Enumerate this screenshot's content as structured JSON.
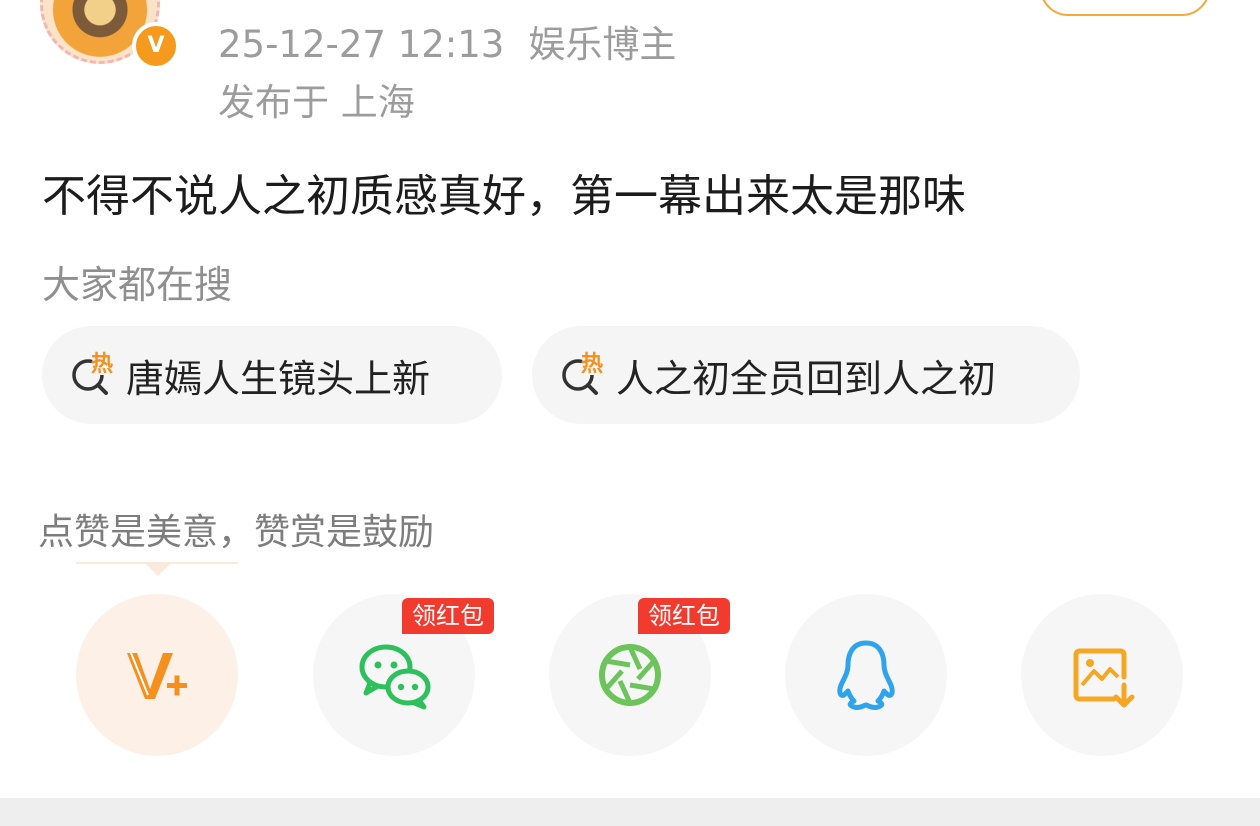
{
  "post": {
    "timestamp": "25-12-27 12:13",
    "author_tag": "娱乐博主",
    "location": "发布于 上海",
    "verified_badge": "V",
    "text": "不得不说人之初质感真好，第一幕出来太是那味"
  },
  "trending": {
    "title": "大家都在搜",
    "hot_icon_glyph": "热",
    "items": [
      {
        "label": "唐嫣人生镜头上新"
      },
      {
        "label": "人之初全员回到人之初"
      }
    ]
  },
  "reward": {
    "text": "点赞是美意，赞赏是鼓励"
  },
  "share": {
    "badge_label": "领红包",
    "buttons": [
      {
        "name": "reward-vplus",
        "icon": "v-plus-icon",
        "color": "#f5901e"
      },
      {
        "name": "wechat",
        "icon": "wechat-icon",
        "color": "#2ec05c",
        "badge": "领红包"
      },
      {
        "name": "moments",
        "icon": "moments-aperture-icon",
        "color": "#6cc45a",
        "badge": "领红包"
      },
      {
        "name": "qq",
        "icon": "qq-penguin-icon",
        "color": "#2fa3ec"
      },
      {
        "name": "save-image",
        "icon": "save-image-icon",
        "color": "#f5a623"
      }
    ]
  },
  "colors": {
    "accent": "#f5901e",
    "badge_red": "#f23b2f",
    "meta_gray": "#9c9c9c"
  }
}
